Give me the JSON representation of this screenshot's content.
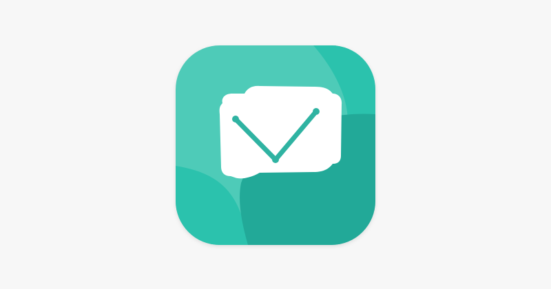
{
  "app_icon": {
    "icon_name": "checkmark-envelope-icon",
    "colors": {
      "background": "#f7f7f7",
      "tile_light": "#4ecbb8",
      "tile_mid": "#2bc2ad",
      "tile_dark": "#22a998",
      "card": "#ffffff",
      "check": "#2fb3a2"
    }
  }
}
